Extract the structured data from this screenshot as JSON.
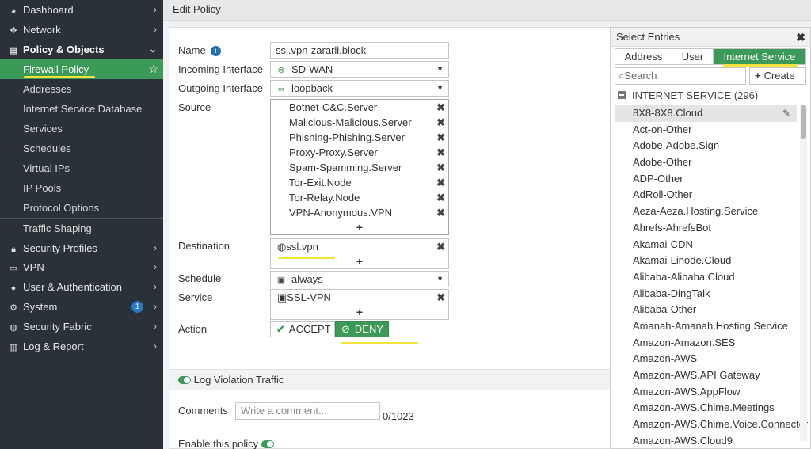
{
  "sidebar": {
    "items": [
      {
        "label": "Dashboard",
        "icon": "dashboard-icon"
      },
      {
        "label": "Network",
        "icon": "network-icon"
      },
      {
        "label": "Policy & Objects",
        "icon": "policy-icon"
      },
      {
        "label": "Security Profiles",
        "icon": "security-profiles-icon"
      },
      {
        "label": "VPN",
        "icon": "vpn-icon"
      },
      {
        "label": "User & Authentication",
        "icon": "user-icon"
      },
      {
        "label": "System",
        "icon": "gear-icon",
        "badge": "1"
      },
      {
        "label": "Security Fabric",
        "icon": "fabric-icon"
      },
      {
        "label": "Log & Report",
        "icon": "log-icon"
      }
    ],
    "policy_subitems": [
      "Firewall Policy",
      "Addresses",
      "Internet Service Database",
      "Services",
      "Schedules",
      "Virtual IPs",
      "IP Pools",
      "Protocol Options",
      "Traffic Shaping"
    ]
  },
  "header": {
    "title": "Edit Policy"
  },
  "form": {
    "name_label": "Name",
    "name_value": "ssl.vpn-zararli.block",
    "incoming_label": "Incoming Interface",
    "incoming_value": "SD-WAN",
    "outgoing_label": "Outgoing Interface",
    "outgoing_value": "loopback",
    "source_label": "Source",
    "source_items": [
      "Botnet-C&C.Server",
      "Malicious-Malicious.Server",
      "Phishing-Phishing.Server",
      "Proxy-Proxy.Server",
      "Spam-Spamming.Server",
      "Tor-Exit.Node",
      "Tor-Relay.Node",
      "VPN-Anonymous.VPN"
    ],
    "destination_label": "Destination",
    "destination_value": "ssl.vpn",
    "schedule_label": "Schedule",
    "schedule_value": "always",
    "service_label": "Service",
    "service_value": "SSL-VPN",
    "action_label": "Action",
    "accept_label": "ACCEPT",
    "deny_label": "DENY",
    "log_violation_label": "Log Violation Traffic",
    "comments_label": "Comments",
    "comments_placeholder": "Write a comment...",
    "comments_count": "0/1023",
    "enable_label": "Enable this policy",
    "plus": "+"
  },
  "entries": {
    "title": "Select Entries",
    "tabs": [
      "Address",
      "User",
      "Internet Service"
    ],
    "search_placeholder": "Search",
    "create_label": "Create",
    "group_label": "INTERNET SERVICE (296)",
    "list": [
      "8X8-8X8.Cloud",
      "Act-on-Other",
      "Adobe-Adobe.Sign",
      "Adobe-Other",
      "ADP-Other",
      "AdRoll-Other",
      "Aeza-Aeza.Hosting.Service",
      "Ahrefs-AhrefsBot",
      "Akamai-CDN",
      "Akamai-Linode.Cloud",
      "Alibaba-Alibaba.Cloud",
      "Alibaba-DingTalk",
      "Alibaba-Other",
      "Amanah-Amanah.Hosting.Service",
      "Amazon-Amazon.SES",
      "Amazon-AWS",
      "Amazon-AWS.API.Gateway",
      "Amazon-AWS.AppFlow",
      "Amazon-AWS.Chime.Meetings",
      "Amazon-AWS.Chime.Voice.Connector",
      "Amazon-AWS.Cloud9"
    ]
  },
  "colors": {
    "accent": "#3b9a57",
    "sidebar_bg": "#2a3138",
    "highlight": "#f2e23b",
    "badge": "#2478c9"
  }
}
